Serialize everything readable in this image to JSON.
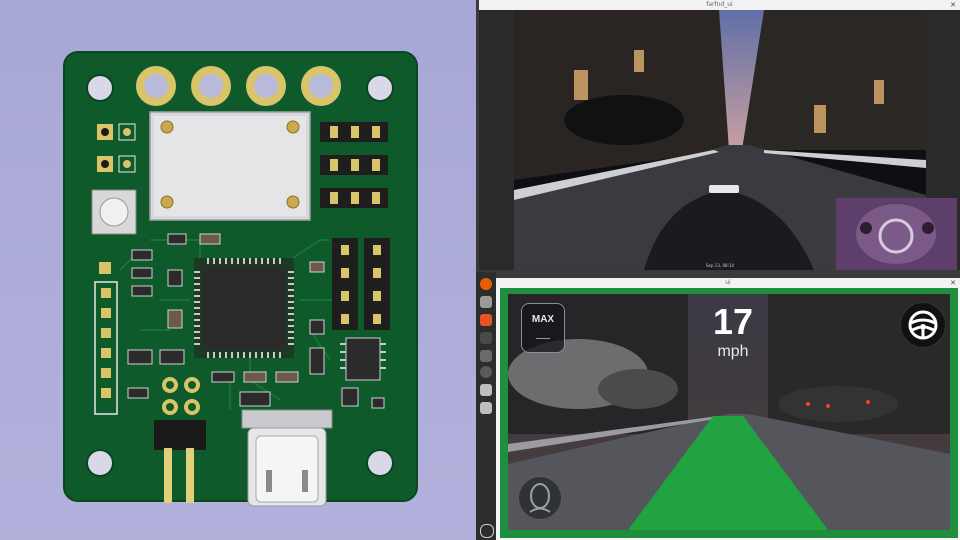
{
  "pcb": {
    "mounting_hole_count": 4,
    "top_pad_count": 4,
    "colors": {
      "board": "#0f5a2b",
      "silk": "#e8e8e8",
      "gold": "#d9c46a",
      "chip": "#2b2b2b",
      "shield": "#d7d9dc"
    }
  },
  "video_window": {
    "title": "farfnd_ui",
    "timestamp": "Sep 13, 08:14"
  },
  "taskbar": {
    "icons": [
      "firefox-icon",
      "files-icon",
      "software-icon",
      "terminal-icon",
      "settings-icon",
      "help-icon",
      "disk-icon",
      "trash-icon",
      "apps-grid-icon"
    ]
  },
  "ui_window": {
    "title": "ui",
    "max_label": "MAX",
    "max_value": "—",
    "speed": "17",
    "speed_unit": "mph",
    "colors": {
      "engaged_border": "#1f8f3f",
      "path": "#1fa83f"
    }
  }
}
